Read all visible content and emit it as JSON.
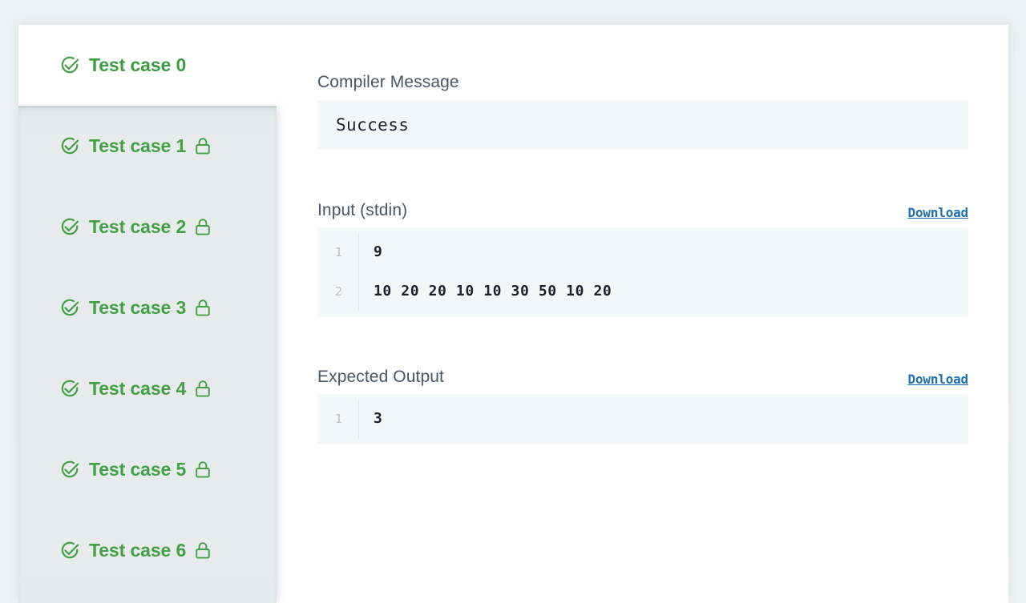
{
  "sidebar": {
    "active_index": 0,
    "items": [
      {
        "label": "Test case 0",
        "status_icon": "check-circle-icon",
        "locked": false
      },
      {
        "label": "Test case 1",
        "status_icon": "check-circle-icon",
        "locked": true
      },
      {
        "label": "Test case 2",
        "status_icon": "check-circle-icon",
        "locked": true
      },
      {
        "label": "Test case 3",
        "status_icon": "check-circle-icon",
        "locked": true
      },
      {
        "label": "Test case 4",
        "status_icon": "check-circle-icon",
        "locked": true
      },
      {
        "label": "Test case 5",
        "status_icon": "check-circle-icon",
        "locked": true
      },
      {
        "label": "Test case 6",
        "status_icon": "check-circle-icon",
        "locked": true
      }
    ]
  },
  "compiler": {
    "title": "Compiler Message",
    "message": "Success"
  },
  "input": {
    "title": "Input (stdin)",
    "download_label": "Download",
    "lines": [
      {
        "no": "1",
        "text": "9"
      },
      {
        "no": "2",
        "text": "10 20 20 10 10 30 50 10 20"
      }
    ]
  },
  "expected": {
    "title": "Expected Output",
    "download_label": "Download",
    "lines": [
      {
        "no": "1",
        "text": "3"
      }
    ]
  },
  "colors": {
    "pass_green": "#43a047",
    "link_blue": "#1f6fb2",
    "label_gray": "#4a5568",
    "code_bg": "#f3f7f8",
    "panel_gray": "#e7ebec",
    "line_number": "#b6c2c6"
  }
}
